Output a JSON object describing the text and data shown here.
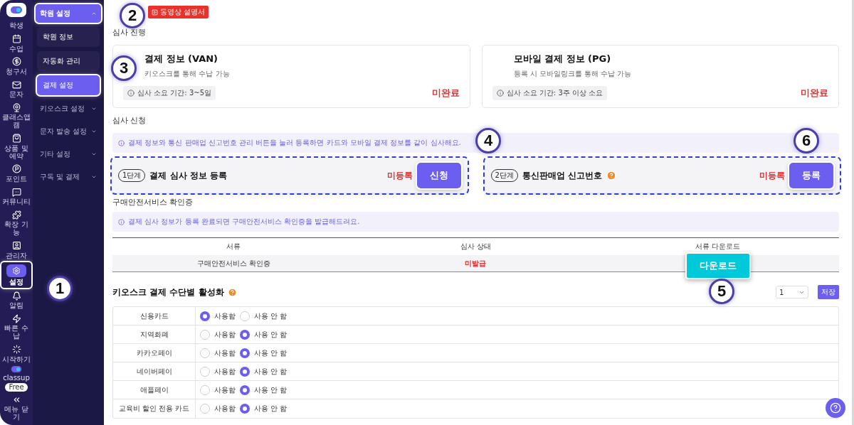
{
  "rail": {
    "items": [
      {
        "label": "학생",
        "selected": false,
        "highlighted": false
      },
      {
        "label": "수업",
        "selected": false,
        "highlighted": false
      },
      {
        "label": "청구서",
        "selected": false,
        "highlighted": false
      },
      {
        "label": "문자",
        "selected": false,
        "highlighted": false
      },
      {
        "label": "클래스앱캠",
        "selected": false,
        "highlighted": false
      },
      {
        "label": "상품 및 예약",
        "selected": false,
        "highlighted": false
      },
      {
        "label": "포인트",
        "selected": false,
        "highlighted": false
      },
      {
        "label": "커뮤니티",
        "selected": false,
        "highlighted": false
      },
      {
        "label": "확장 기능",
        "selected": false,
        "highlighted": false
      },
      {
        "label": "관리자",
        "selected": false,
        "highlighted": false
      },
      {
        "label": "설정",
        "selected": true,
        "highlighted": true
      },
      {
        "label": "알림",
        "selected": false,
        "highlighted": false
      },
      {
        "label": "빠른 수납",
        "selected": false,
        "highlighted": false
      },
      {
        "label": "시작하기",
        "selected": false,
        "highlighted": false
      }
    ],
    "brand": {
      "name": "classup",
      "plan": "Free"
    },
    "collapse": "메뉴 닫기"
  },
  "menu": [
    {
      "label": "학원 설정",
      "expanded": true,
      "highlighted": true,
      "children": [
        {
          "label": "학원 정보",
          "selected": false,
          "highlighted": false
        },
        {
          "label": "자동화 관리",
          "selected": false,
          "highlighted": false
        },
        {
          "label": "결제 설정",
          "selected": true,
          "highlighted": true
        }
      ]
    },
    {
      "label": "키오스크 설정",
      "expanded": false,
      "highlighted": false
    },
    {
      "label": "문자 발송 설정",
      "expanded": false,
      "highlighted": false
    },
    {
      "label": "기타 설정",
      "expanded": false,
      "highlighted": false
    },
    {
      "label": "구독 및 결제",
      "expanded": false,
      "highlighted": false
    }
  ],
  "header": {
    "video_button": "동영상 설명서",
    "section_label": "심사 진행"
  },
  "cards": [
    {
      "title": "결제 정보 (VAN)",
      "description": "키오스크를 통해 수납 가능",
      "duration": "심사 소요 기간: 3~5일",
      "status": "미완료"
    },
    {
      "title": "모바일 결제 정보 (PG)",
      "description": "등록 시 모바일링크를 통해 수납 가능",
      "duration": "심사 소요 기간: 3주 이상 소요",
      "status": "미완료"
    }
  ],
  "apply": {
    "label": "심사 신청",
    "notice": "결제 정보와 통신 판매업 신고번호 관리 버튼을 눌러 등록하면 카드와 모바일 결제 정보를 같이 심사해요.",
    "steps": [
      {
        "step": "1단계",
        "title": "결제 심사 정보 등록",
        "help": false,
        "status": "미등록",
        "button": "신청",
        "highlighted": true
      },
      {
        "step": "2단계",
        "title": "통신판매업 신고번호",
        "help": true,
        "status": "미등록",
        "button": "등록",
        "highlighted": true
      }
    ]
  },
  "certificate": {
    "label": "구매안전서비스 확인증",
    "notice": "결제 심사 정보가 등록 완료되면 구매안전서비스 확인증을 발급해드려요.",
    "columns": [
      "서류",
      "심사 상태",
      "서류 다운로드"
    ],
    "rows": [
      {
        "document": "구매안전서비스 확인증",
        "status": "미발급",
        "download": "다운로드",
        "highlighted": true
      }
    ]
  },
  "kiosk": {
    "title": "키오스크 결제 수단별 활성화",
    "select": "1",
    "save": "저장",
    "rows": [
      {
        "method": "신용카드",
        "options": [
          {
            "label": "사용함",
            "selected": true
          },
          {
            "label": "사용 안 함",
            "selected": false
          }
        ]
      },
      {
        "method": "지역화폐",
        "options": [
          {
            "label": "사용함",
            "selected": false
          },
          {
            "label": "사용 안 함",
            "selected": true
          }
        ]
      },
      {
        "method": "카카오페이",
        "options": [
          {
            "label": "사용함",
            "selected": false
          },
          {
            "label": "사용 안 함",
            "selected": true
          }
        ]
      },
      {
        "method": "네이버페이",
        "options": [
          {
            "label": "사용함",
            "selected": false
          },
          {
            "label": "사용 안 함",
            "selected": true
          }
        ]
      },
      {
        "method": "애플페이",
        "options": [
          {
            "label": "사용함",
            "selected": false
          },
          {
            "label": "사용 안 함",
            "selected": true
          }
        ]
      },
      {
        "method": "교육비 할인 전용 카드",
        "options": [
          {
            "label": "사용함",
            "selected": false
          },
          {
            "label": "사용 안 함",
            "selected": true
          }
        ]
      }
    ]
  },
  "callouts": [
    "1",
    "2",
    "3",
    "4",
    "5",
    "6"
  ]
}
